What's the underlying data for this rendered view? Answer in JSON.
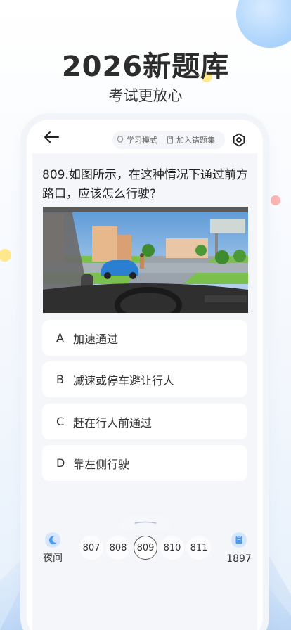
{
  "hero": {
    "title": "2026新题库",
    "subtitle": "考试更放心"
  },
  "topbar": {
    "back_icon": "arrow-left-icon",
    "study_mode_label": "学习模式",
    "add_wrong_label": "加入错题集",
    "settings_icon": "gear-icon"
  },
  "question": {
    "text": "809.如图所示，在这种情况下通过前方路口，应该怎么行驶?"
  },
  "options": [
    {
      "letter": "A",
      "text": "加速通过"
    },
    {
      "letter": "B",
      "text": "减速或停车避让行人"
    },
    {
      "letter": "C",
      "text": "赶在行人前通过"
    },
    {
      "letter": "D",
      "text": "靠左侧行驶"
    }
  ],
  "bottom": {
    "night_label": "夜间",
    "numbers": [
      "807",
      "808",
      "809",
      "810",
      "811"
    ],
    "active_number": "809",
    "total": "1897"
  },
  "colors": {
    "accent": "#4d9cf0",
    "hero_text": "#2c2c2c",
    "option_bg": "#ffffff",
    "page_bg": "#f4f6fa"
  }
}
